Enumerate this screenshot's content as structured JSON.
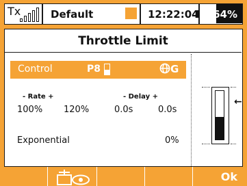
{
  "status_bar": {
    "tx_label": "Tx",
    "model_name": "Default",
    "time": "12:22:04",
    "battery_percent": "64%",
    "battery_fraction": 0.64
  },
  "screen": {
    "title": "Throttle Limit",
    "control": {
      "label": "Control",
      "switch": "P8",
      "switch_level": 0.5,
      "global_icon_text": "G"
    },
    "rate": {
      "header": "- Rate +",
      "minus": "100%",
      "plus": "120%"
    },
    "delay": {
      "header": "- Delay +",
      "minus": "0.0s",
      "plus": "0.0s"
    },
    "exponential": {
      "label": "Exponential",
      "value": "0%"
    },
    "gauge": {
      "level": 0.46,
      "arrow": "←"
    }
  },
  "softkeys": {
    "ok": "Ok"
  },
  "colors": {
    "accent": "#f5a335",
    "ink": "#111111",
    "background": "#ffffff"
  }
}
